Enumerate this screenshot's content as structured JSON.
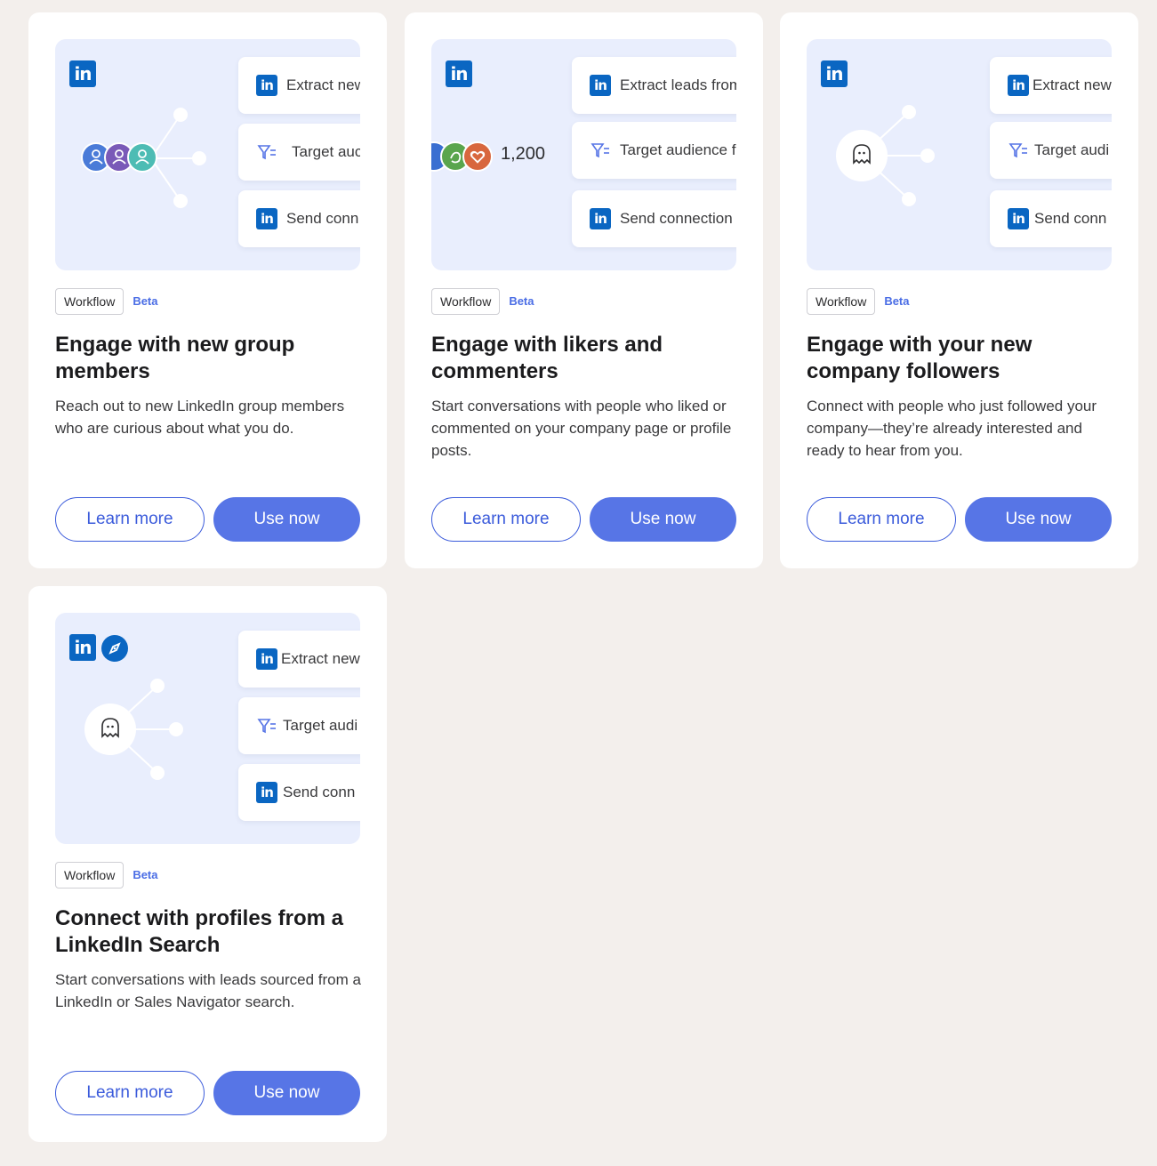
{
  "colors": {
    "accent": "#5775e6",
    "linkedin": "#0a66c2",
    "beta": "#4a6de5",
    "background": "#f3efec",
    "illustration_bg": "#e9eefd"
  },
  "cards": [
    {
      "icons": [
        "linkedin-icon"
      ],
      "rows": [
        {
          "icon": "linkedin-icon",
          "text": "Extract new"
        },
        {
          "icon": "filter-icon",
          "text": "Target auc"
        },
        {
          "icon": "linkedin-icon",
          "text": "Send conn"
        }
      ],
      "tag": "Workflow",
      "badge": "Beta",
      "title": "Engage with new group members",
      "description": "Reach out to new LinkedIn group members who are curious about what you do.",
      "learn_more": "Learn more",
      "use_now": "Use now"
    },
    {
      "icons": [
        "linkedin-icon"
      ],
      "count": "1,200",
      "rows": [
        {
          "icon": "linkedin-icon",
          "text": "Extract leads from"
        },
        {
          "icon": "filter-icon",
          "text": "Target audience f"
        },
        {
          "icon": "linkedin-icon",
          "text": "Send connection"
        }
      ],
      "tag": "Workflow",
      "badge": "Beta",
      "title": "Engage with likers and commenters",
      "description": "Start conversations with people who liked or commented on your company page or profile posts.",
      "learn_more": "Learn more",
      "use_now": "Use now"
    },
    {
      "icons": [
        "linkedin-icon"
      ],
      "rows": [
        {
          "icon": "linkedin-icon",
          "text": "Extract new"
        },
        {
          "icon": "filter-icon",
          "text": "Target audi"
        },
        {
          "icon": "linkedin-icon",
          "text": "Send conn"
        }
      ],
      "tag": "Workflow",
      "badge": "Beta",
      "title": "Engage with your new company followers",
      "description": "Connect with people who just followed your company—they’re already interested and ready to hear from you.",
      "learn_more": "Learn more",
      "use_now": "Use now"
    },
    {
      "icons": [
        "linkedin-icon",
        "compass-icon"
      ],
      "rows": [
        {
          "icon": "linkedin-icon",
          "text": "Extract new"
        },
        {
          "icon": "filter-icon",
          "text": "Target audi"
        },
        {
          "icon": "linkedin-icon",
          "text": "Send conn"
        }
      ],
      "tag": "Workflow",
      "badge": "Beta",
      "title": "Connect with profiles from a LinkedIn Search",
      "description": "Start conversations with leads sourced from a LinkedIn or Sales Navigator search.",
      "learn_more": "Learn more",
      "use_now": "Use now"
    }
  ]
}
